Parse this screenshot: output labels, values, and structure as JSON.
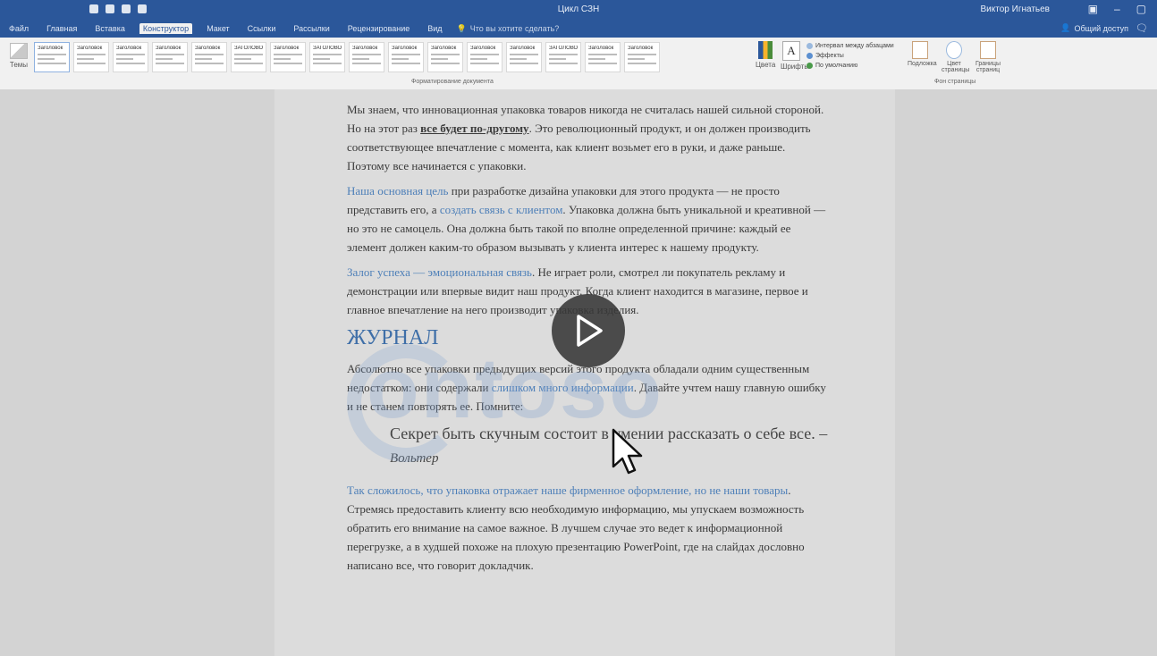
{
  "titlebar": {
    "doc_title": "Цикл СЗН",
    "user": "Виктор Игнатьев",
    "qat_icons": [
      "save-icon",
      "undo-icon",
      "redo-icon",
      "customize-icon"
    ]
  },
  "tabs": {
    "items": [
      "Файл",
      "Главная",
      "Вставка",
      "Конструктор",
      "Макет",
      "Ссылки",
      "Рассылки",
      "Рецензирование",
      "Вид"
    ],
    "active": "Конструктор",
    "tell_me": "Что вы хотите сделать?",
    "share": "Общий доступ"
  },
  "ribbon": {
    "themes_label": "Темы",
    "styles": [
      "Заголовок",
      "Заголовок",
      "Заголовок",
      "Заголовок",
      "Заголовок",
      "ЗАГОЛОВОК",
      "Заголовок",
      "ЗАГОЛОВОК",
      "Заголовок",
      "Заголовок",
      "Заголовок",
      "Заголовок",
      "Заголовок",
      "ЗАГОЛОВОК",
      "Заголовок",
      "Заголовок"
    ],
    "format_group": "Форматирование документа",
    "colors_label": "Цвета",
    "fonts_label": "Шрифты",
    "paragraph_spacing": "Интервал между абзацами",
    "effects": "Эффекты",
    "default": "По умолчанию",
    "watermark_btn": "Подложка",
    "page_color_btn": "Цвет страницы",
    "page_borders_btn": "Границы страниц",
    "bg_group": "Фон страницы"
  },
  "doc": {
    "p1_a": "Мы знаем, что инновационная упаковка товаров никогда не считалась нашей сильной стороной. Но на этот раз ",
    "p1_b": "все будет по-другому",
    "p1_c": ". Это революционный продукт, и он должен производить соответствующее впечатление с момента, как клиент возьмет его в руки, и даже раньше. Поэтому все начинается с упаковки.",
    "p2_a": "Наша основная цель",
    "p2_b": " при разработке дизайна упаковки для этого продукта — не просто представить его, а ",
    "p2_c": "создать связь с клиентом",
    "p2_d": ". Упаковка должна быть уникальной и креативной — но это не самоцель. Она должна быть такой по вполне определенной причине: каждый ее элемент должен каким-то образом вызывать у клиента интерес к нашему продукту.",
    "p3_a": "Залог успеха — эмоциональная связь",
    "p3_b": ". Не играет роли, смотрел ли покупатель рекламу и демонстрации или впервые видит наш продукт. Когда клиент находится в магазине, первое и главное впечатление на него производит упаковка изделия.",
    "heading": "ЖУРНАЛ",
    "p4_a": "Абсолютно все упаковки предыдущих версий этого продукта обладали одним существенным недостатком: они содержали ",
    "p4_b": "слишком много информации",
    "p4_c": ". Давайте учтем нашу главную ошибку и не станем повторять ее. Помните:",
    "quote_text": "Секрет быть скучным состоит в умении рассказать о себе все. –",
    "quote_author": "Вольтер",
    "p5_a": "Так сложилось, что упаковка отражает наше фирменное оформление, но не наши товары",
    "p5_b": ". Стремясь предоставить клиенту всю необходимую информацию, мы упускаем возможность обратить его внимание на самое важное. В лучшем случае это ведет к информационной перегрузке, а в худшей похоже на плохую презентацию PowerPoint, где на слайдах дословно написано все, что говорит докладчик.",
    "watermark": "ontoso"
  },
  "colors": {
    "word_blue": "#2b579a",
    "accent_text": "#4d7fb8"
  }
}
